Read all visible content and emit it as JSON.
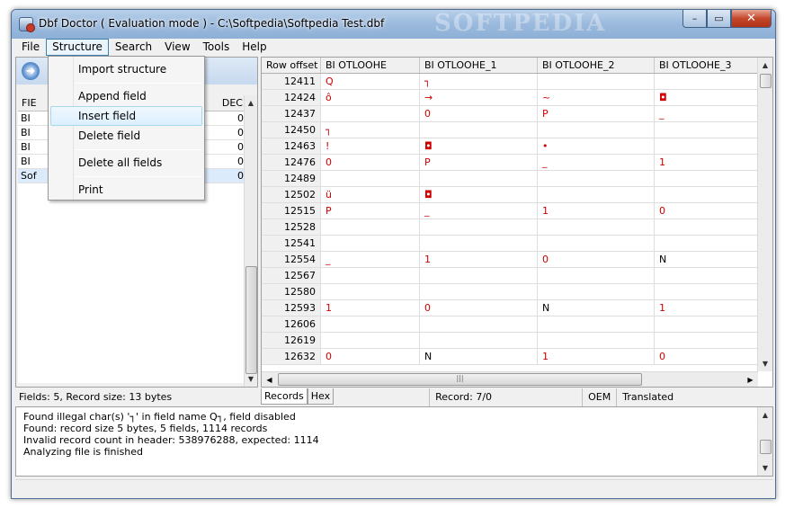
{
  "window": {
    "title": "Dbf Doctor ( Evaluation mode ) - C:\\Softpedia\\Softpedia Test.dbf",
    "watermark": "SOFTPEDIA",
    "buttons": {
      "min": "–",
      "max": "▭",
      "close": "✕"
    }
  },
  "menu": {
    "items": [
      "File",
      "Structure",
      "Search",
      "View",
      "Tools",
      "Help"
    ],
    "active_index": 1
  },
  "structure_menu": {
    "items": [
      "Import structure",
      "Append field",
      "Insert field",
      "Delete field",
      "Delete all fields",
      "Print"
    ],
    "hover_index": 2
  },
  "fields_grid": {
    "headers": [
      "FIE",
      "DEC"
    ],
    "rows": [
      {
        "name": "BI",
        "dec": "0"
      },
      {
        "name": "BI",
        "dec": "0"
      },
      {
        "name": "BI",
        "dec": "0"
      },
      {
        "name": "BI",
        "dec": "0"
      },
      {
        "name": "Sof",
        "dec": "0"
      }
    ],
    "selected_index": 4
  },
  "records": {
    "headers": [
      "Row offset",
      "BI  OTLOOHE",
      "BI  OTLOOHE_1",
      "BI  OTLOOHE_2",
      "BI  OTLOOHE_3"
    ],
    "rows": [
      [
        "12411",
        "Q",
        "┐",
        "",
        ""
      ],
      [
        "12424",
        "ô",
        "→",
        "~",
        "◘"
      ],
      [
        "12437",
        "",
        "0",
        "P",
        "_"
      ],
      [
        "12450",
        "┐",
        "",
        "",
        ""
      ],
      [
        "12463",
        "!",
        "◘",
        "•",
        ""
      ],
      [
        "12476",
        "0",
        "P",
        "_",
        "1"
      ],
      [
        "12489",
        "",
        "",
        "",
        ""
      ],
      [
        "12502",
        "ü",
        "◘",
        "",
        ""
      ],
      [
        "12515",
        "P",
        "_",
        "1",
        "0"
      ],
      [
        "12528",
        "",
        "",
        "",
        ""
      ],
      [
        "12541",
        "",
        "",
        "",
        ""
      ],
      [
        "12554",
        "_",
        "1",
        "0",
        "N"
      ],
      [
        "12567",
        "",
        "",
        "",
        ""
      ],
      [
        "12580",
        "",
        "",
        "",
        ""
      ],
      [
        "12593",
        "1",
        "0",
        "N",
        "1"
      ],
      [
        "12606",
        "",
        "",
        "",
        ""
      ],
      [
        "12619",
        "",
        "",
        "",
        ""
      ],
      [
        "12632",
        "0",
        "N",
        "1",
        "0"
      ]
    ]
  },
  "status": {
    "left": "Fields: 5, Record size: 13 bytes",
    "tabs": [
      "Records",
      "Hex"
    ],
    "record": "Record: 7/0",
    "oem": "OEM",
    "translated": "Translated"
  },
  "log": [
    "Found illegal char(s) '┐' in field name Q┐, field disabled",
    "Found: record size 5 bytes, 5 fields, 1114 records",
    "Invalid record count in header: 538976288, expected: 1114",
    "Analyzing file is finished"
  ],
  "colors": {
    "data_text": "#d00000",
    "title_gradient": "#9ab9dd"
  }
}
